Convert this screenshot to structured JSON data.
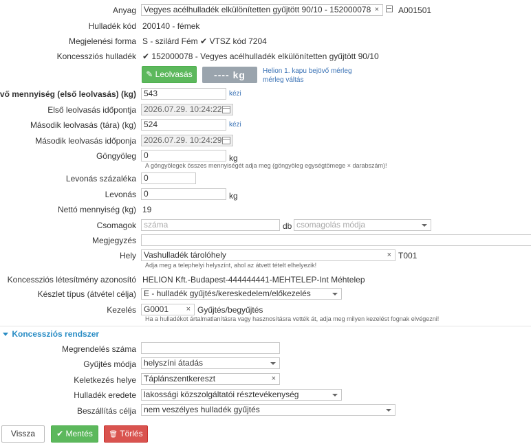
{
  "fields": {
    "anyag": {
      "label": "Anyag",
      "value": "Vegyes acélhulladék elkülönítetten gyűjtött 90/10 - 152000078",
      "code": "A001501"
    },
    "hulladek_kod": {
      "label": "Hulladék kód",
      "value": "200140 - fémek"
    },
    "megjelenesi_forma": {
      "label": "Megjelenési forma",
      "value": "S - szilárd Fém",
      "vtsz": "VTSZ kód 7204"
    },
    "koncesszios_hulladek": {
      "label": "Koncessziós hulladék",
      "value": "152000078 - Vegyes acélhulladék elkülönítetten gyűjtött 90/10"
    },
    "leolvasas": {
      "button": "Leolvasás",
      "scale_display": "---- kg",
      "scale_name": "Helion 1. kapu bejövő mérleg",
      "scale_switch": "mérleg váltás"
    },
    "bejovo": {
      "label": "Bejövő mennyiség (első leolvasás) (kg)",
      "value": "543",
      "mode": "kézi"
    },
    "elso_idopont": {
      "label": "Első leolvasás időpontja",
      "value": "2026.07.29. 10:24:22"
    },
    "masodik": {
      "label": "Második leolvasás (tára) (kg)",
      "value": "524",
      "mode": "kézi"
    },
    "masodik_idopont": {
      "label": "Második leolvasás időponja",
      "value": "2026.07.29. 10:24:29"
    },
    "gongyoleg": {
      "label": "Göngyöleg",
      "value": "0",
      "unit": "kg",
      "hint": "A göngyölegek összes mennyiségét adja meg (göngyöleg egységtömege × darabszám)!"
    },
    "levonas_szazalek": {
      "label": "Levonás százaléka",
      "value": "0"
    },
    "levonas": {
      "label": "Levonás",
      "value": "0",
      "unit": "kg"
    },
    "netto": {
      "label": "Nettó mennyiség (kg)",
      "value": "19"
    },
    "csomagok": {
      "label": "Csomagok",
      "placeholder": "száma",
      "unit": "db",
      "mode_placeholder": "csomagolás módja"
    },
    "megjegyzes": {
      "label": "Megjegyzés",
      "value": ""
    },
    "hely": {
      "label": "Hely",
      "value": "Vashulladék tárolóhely",
      "code": "T001",
      "hint": "Adja meg a telephelyi helyszínt, ahol az átvett tételt elhelyezik!"
    },
    "letesitmeny": {
      "label": "Koncessziós létesítmény azonosító",
      "value": "HELION Kft.-Budapest-444444441-MEHTELEP-Int Méhtelep"
    },
    "keszlet_tipus": {
      "label": "Készlet típus (átvétel célja)",
      "value": "E - hulladék gyűjtés/kereskedelem/előkezelés"
    },
    "kezeles": {
      "label": "Kezelés",
      "value": "G0001",
      "desc": "Gyűjtés/begyűjtés",
      "hint": "Ha a hulladékot ártalmatlanításra vagy hasznosításra vették át, adja meg milyen kezelést fognak elvégezni!"
    }
  },
  "section": {
    "title": "Koncessziós rendszer"
  },
  "koncesszio": {
    "megrendeles": {
      "label": "Megrendelés száma",
      "value": ""
    },
    "gyujtes_modja": {
      "label": "Gyűjtés módja",
      "value": "helyszíni átadás"
    },
    "keletkezes_helye": {
      "label": "Keletkezés helye",
      "value": "Táplánszentkereszt"
    },
    "hulladek_eredete": {
      "label": "Hulladék eredete",
      "value": "lakossági közszolgáltatói résztevékenység"
    },
    "beszallitas_celja": {
      "label": "Beszállítás célja",
      "value": "nem veszélyes hulladék gyűjtés"
    }
  },
  "buttons": {
    "back": "Vissza",
    "save": "Mentés",
    "delete": "Törlés"
  },
  "icons": {
    "check": "✔",
    "clear": "×",
    "pencil": "✎",
    "save_check": "✔",
    "trash": "🗑"
  },
  "colors": {
    "green": "#5cb85c",
    "red": "#d9534f",
    "link": "#3a72b5",
    "section": "#2a8dc5"
  }
}
